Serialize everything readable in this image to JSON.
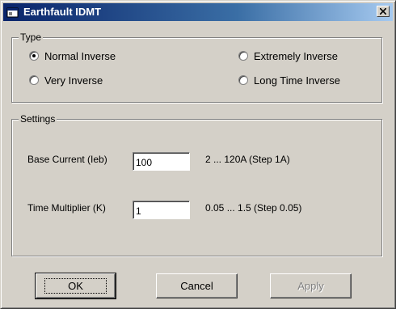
{
  "window": {
    "title": "Earthfault IDMT",
    "icon": "app-window-icon",
    "close_icon": "close-icon"
  },
  "type_group": {
    "legend": "Type",
    "options": [
      {
        "label": "Normal Inverse",
        "checked": true
      },
      {
        "label": "Very Inverse",
        "checked": false
      },
      {
        "label": "Extremely Inverse",
        "checked": false
      },
      {
        "label": "Long Time Inverse",
        "checked": false
      }
    ]
  },
  "settings_group": {
    "legend": "Settings",
    "base_current": {
      "label": "Base Current (Ieb)",
      "value": "100",
      "range": "2 ...  120A (Step 1A)"
    },
    "time_multiplier": {
      "label": "Time Multiplier (K)",
      "value": "1",
      "range": "0.05  ...  1.5 (Step 0.05)"
    }
  },
  "buttons": {
    "ok": "OK",
    "cancel": "Cancel",
    "apply": "Apply"
  }
}
